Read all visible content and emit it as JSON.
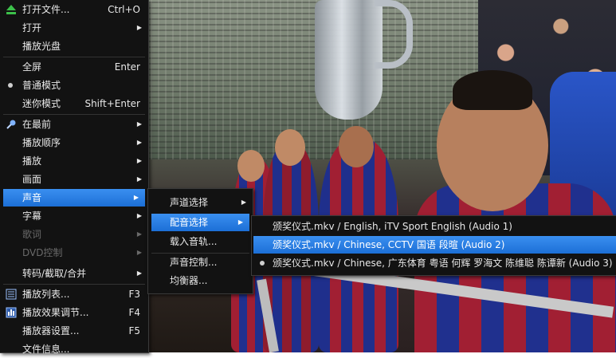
{
  "menu": {
    "items": [
      {
        "label": "打开文件...",
        "shortcut": "Ctrl+O",
        "icon": "eject-icon",
        "type": "item"
      },
      {
        "label": "打开",
        "shortcut": "",
        "submenu": true,
        "type": "item"
      },
      {
        "label": "播放光盘",
        "shortcut": "",
        "type": "item"
      },
      {
        "label": "全屏",
        "shortcut": "Enter",
        "type": "item"
      },
      {
        "label": "普通模式",
        "shortcut": "",
        "checked": true,
        "type": "item"
      },
      {
        "label": "迷你模式",
        "shortcut": "Shift+Enter",
        "type": "item"
      },
      {
        "label": "在最前",
        "shortcut": "",
        "submenu": true,
        "icon": "pin-icon",
        "type": "item"
      },
      {
        "label": "播放顺序",
        "shortcut": "",
        "submenu": true,
        "type": "item"
      },
      {
        "label": "播放",
        "shortcut": "",
        "submenu": true,
        "type": "item"
      },
      {
        "label": "画面",
        "shortcut": "",
        "submenu": true,
        "type": "item"
      },
      {
        "label": "声音",
        "shortcut": "",
        "submenu": true,
        "highlighted": true,
        "type": "item"
      },
      {
        "label": "字幕",
        "shortcut": "",
        "submenu": true,
        "type": "item"
      },
      {
        "label": "歌词",
        "shortcut": "",
        "submenu": true,
        "disabled": true,
        "type": "item"
      },
      {
        "label": "DVD控制",
        "shortcut": "",
        "submenu": true,
        "disabled": true,
        "type": "item"
      },
      {
        "label": "转码/截取/合并",
        "shortcut": "",
        "submenu": true,
        "type": "item"
      },
      {
        "label": "播放列表...",
        "shortcut": "F3",
        "icon": "playlist-icon",
        "type": "item"
      },
      {
        "label": "播放效果调节...",
        "shortcut": "F4",
        "icon": "effects-icon",
        "type": "item"
      },
      {
        "label": "播放器设置...",
        "shortcut": "F5",
        "type": "item"
      },
      {
        "label": "文件信息...",
        "shortcut": "",
        "type": "item"
      }
    ]
  },
  "sound_submenu": {
    "items": [
      {
        "label": "声道选择",
        "submenu": true
      },
      {
        "label": "配音选择",
        "submenu": true,
        "highlighted": true
      },
      {
        "label": "载入音轨..."
      },
      {
        "label": "声音控制..."
      },
      {
        "label": "均衡器..."
      }
    ]
  },
  "audio_track_submenu": {
    "items": [
      {
        "label": "颁奖仪式.mkv / English, iTV  Sport English (Audio 1)"
      },
      {
        "label": "颁奖仪式.mkv / Chinese, CCTV 国语 段暄 (Audio 2)",
        "highlighted": true
      },
      {
        "label": "颁奖仪式.mkv / Chinese, 广东体育 粤语 何辉 罗海文 陈维聪 陈谭新 (Audio 3)",
        "checked": true
      }
    ]
  },
  "colors": {
    "highlight": "#2a7fe8",
    "menu_bg": "#121212",
    "text": "#e8e8e8",
    "disabled": "#6a6a6a"
  }
}
